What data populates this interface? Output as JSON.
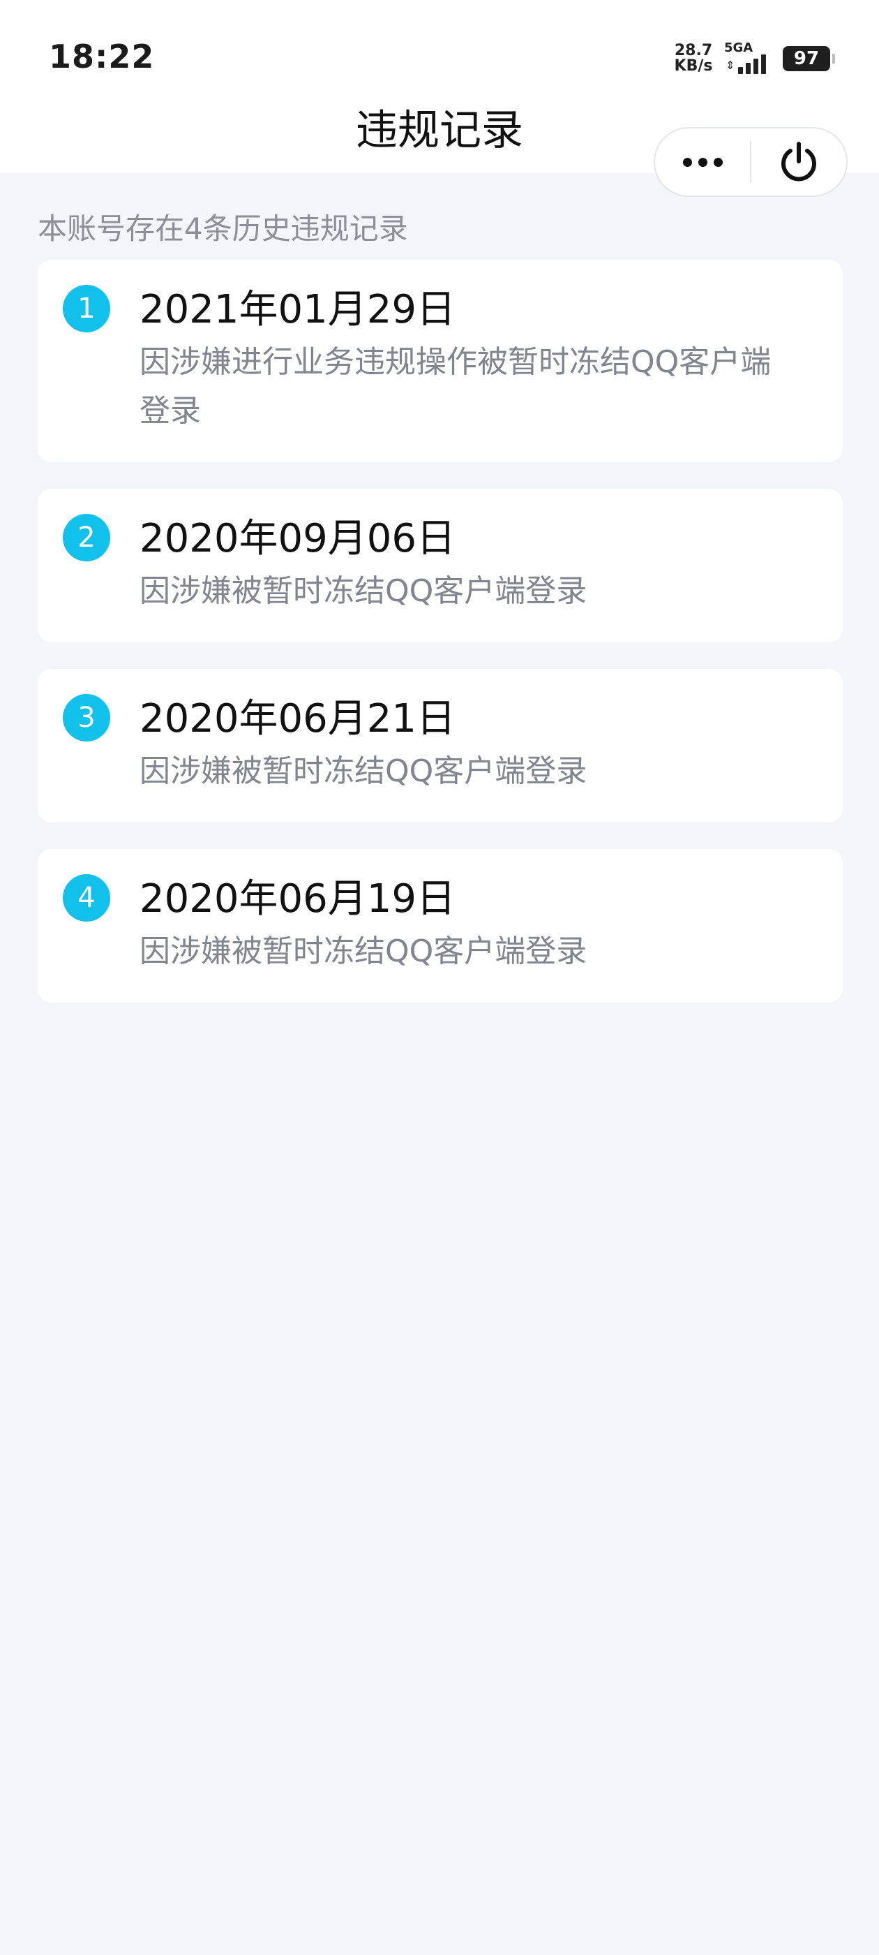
{
  "status_bar": {
    "time": "18:22",
    "net_speed_value": "28.7",
    "net_speed_unit": "KB/s",
    "signal_label": "5GA",
    "signal_arrows": "⇕",
    "battery": "97"
  },
  "header": {
    "title": "违规记录",
    "menu_icon": "more-dots-icon",
    "close_icon": "power-icon"
  },
  "summary_text": "本账号存在4条历史违规记录",
  "records": [
    {
      "index": "1",
      "date": "2021年01月29日",
      "reason": "因涉嫌进行业务违规操作被暂时冻结QQ客户端登录"
    },
    {
      "index": "2",
      "date": "2020年09月06日",
      "reason": "因涉嫌被暂时冻结QQ客户端登录"
    },
    {
      "index": "3",
      "date": "2020年06月21日",
      "reason": "因涉嫌被暂时冻结QQ客户端登录"
    },
    {
      "index": "4",
      "date": "2020年06月19日",
      "reason": "因涉嫌被暂时冻结QQ客户端登录"
    }
  ],
  "colors": {
    "accent": "#12c0ec",
    "background": "#f2f5f9",
    "card": "#ffffff",
    "muted_text": "#80858f"
  }
}
